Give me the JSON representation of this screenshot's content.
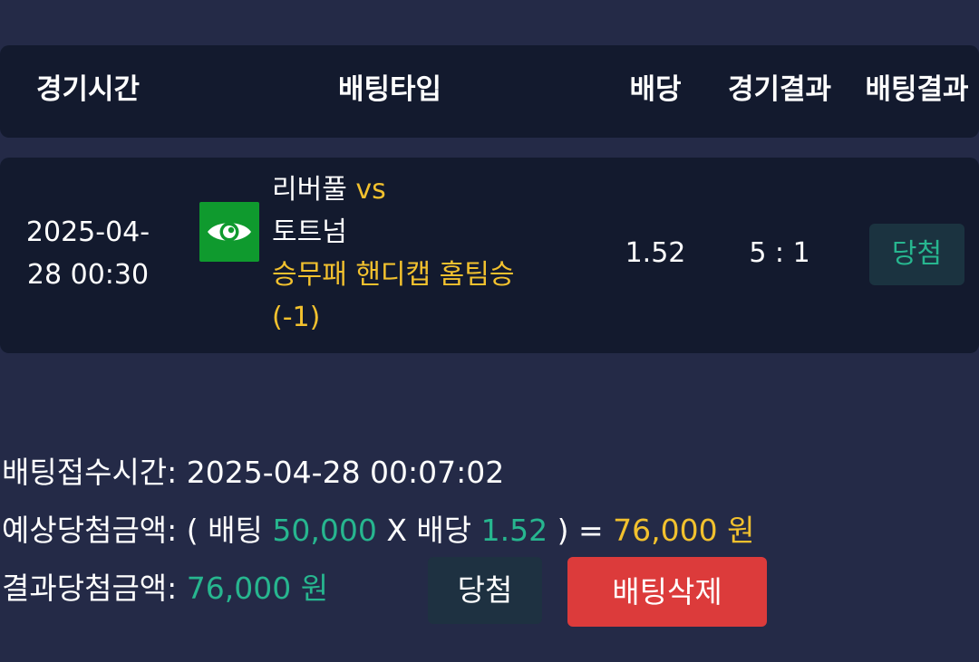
{
  "colors": {
    "page_bg": "#242a47",
    "row_bg": "#131a2e",
    "accent_yellow": "#f2c12e",
    "accent_green": "#27b68f",
    "delete_red": "#dc3b3b",
    "icon_green": "#0f9a2e"
  },
  "table": {
    "headers": {
      "time": "경기시간",
      "bet_type": "배팅타입",
      "odds": "배당",
      "game_result": "경기결과",
      "bet_result": "배팅결과"
    },
    "row": {
      "datetime_date": "2025-04-",
      "datetime_time": "28 00:30",
      "icon": "eye-icon",
      "home_team": "리버풀",
      "vs": "vs",
      "away_team": "토트넘",
      "market_line1": "승무패 핸디캡 홈팀승",
      "market_line2": "(-1)",
      "odds": "1.52",
      "score": "5 : 1",
      "result": "당첨"
    }
  },
  "summary": {
    "time_label": "배팅접수시간: ",
    "time_value": "2025-04-28 00:07:02",
    "expected_label": "예상당첨금액: ",
    "expected_open": "( 배팅 ",
    "expected_stake": "50,000",
    "expected_mid": " X 배당 ",
    "expected_odds": "1.52",
    "expected_close": " ) = ",
    "expected_amount": "76,000 원",
    "result_label": "결과당첨금액: ",
    "result_amount": "76,000 원"
  },
  "buttons": {
    "win_label": "당첨",
    "delete_label": "배팅삭제"
  }
}
